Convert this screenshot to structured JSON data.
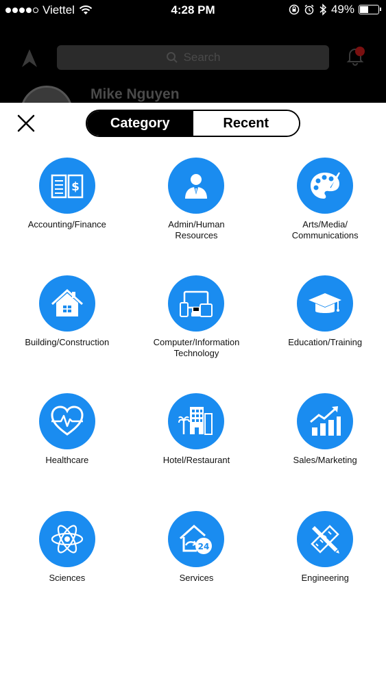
{
  "status_bar": {
    "carrier": "Viettel",
    "time": "4:28 PM",
    "battery_pct": "49%",
    "battery_level": 0.49
  },
  "background": {
    "search_placeholder": "Search",
    "user_name": "Mike Nguyen"
  },
  "tabs": [
    {
      "label": "Category",
      "active": true
    },
    {
      "label": "Recent",
      "active": false
    }
  ],
  "categories": [
    {
      "label": "Accounting/Finance",
      "icon": "ledger-dollar-icon"
    },
    {
      "label": "Admin/Human\nResources",
      "icon": "person-suit-icon"
    },
    {
      "label": "Arts/Media/\nCommunications",
      "icon": "palette-brush-icon"
    },
    {
      "label": "Building/Construction",
      "icon": "house-icon"
    },
    {
      "label": "Computer/Information\nTechnology",
      "icon": "devices-icon"
    },
    {
      "label": "Education/Training",
      "icon": "graduation-cap-icon"
    },
    {
      "label": "Healthcare",
      "icon": "heart-pulse-icon"
    },
    {
      "label": "Hotel/Restaurant",
      "icon": "hotel-palm-icon"
    },
    {
      "label": "Sales/Marketing",
      "icon": "growth-chart-icon"
    },
    {
      "label": "Sciences",
      "icon": "atom-icon"
    },
    {
      "label": "Services",
      "icon": "house-24h-icon"
    },
    {
      "label": "Engineering",
      "icon": "ruler-pencil-icon"
    }
  ],
  "colors": {
    "accent": "#1a8cf0",
    "tab_active_bg": "#000000"
  }
}
